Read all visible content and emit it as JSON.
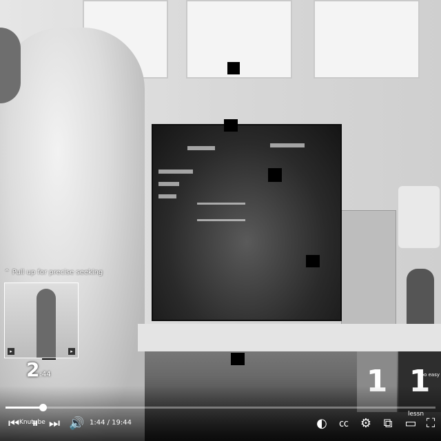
{
  "overlay": {
    "seek_hint": "Pull up for precise seeking",
    "seek_time_big": "2",
    "seek_time_small": ":44",
    "progress": 0.086
  },
  "endscreen": {
    "item1_number": "1",
    "item2_number": "1",
    "item2_tag": "too easy"
  },
  "controls": {
    "time_display": "1:44 / 19:44",
    "left_caption": "Knutube",
    "right_caption": "lessn"
  },
  "icons": {
    "prev": "skip-previous-icon",
    "pause": "pause-icon",
    "next": "skip-next-icon",
    "volume": "volume-icon",
    "autoplay": "autoplay-toggle-icon",
    "captions": "captions-icon",
    "settings": "gear-icon",
    "miniplayer": "miniplayer-icon",
    "theater": "theater-mode-icon",
    "fullscreen": "fullscreen-icon"
  }
}
